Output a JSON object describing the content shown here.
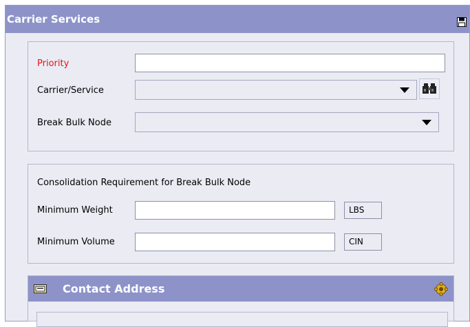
{
  "panel": {
    "title": "Carrier Services"
  },
  "carrier_section": {
    "priority_label": "Priority",
    "priority_value": "",
    "carrier_service_label": "Carrier/Service",
    "carrier_service_value": "",
    "break_bulk_label": "Break Bulk Node",
    "break_bulk_value": ""
  },
  "consolidation_section": {
    "heading": "Consolidation Requirement for Break Bulk Node",
    "min_weight_label": "Minimum Weight",
    "min_weight_value": "",
    "min_weight_unit": "LBS",
    "min_volume_label": "Minimum Volume",
    "min_volume_value": "",
    "min_volume_unit": "CIN"
  },
  "contact_section": {
    "title": "Contact Address"
  },
  "icons": {
    "save": "save-icon",
    "lookup": "binoculars-icon",
    "contact_card": "id-card-icon",
    "settings": "gear-icon",
    "dropdown": "chevron-down-icon"
  },
  "colors": {
    "title_bar": "#8d93c9",
    "panel_bg": "#ebebf3",
    "required_label": "#e11111"
  }
}
